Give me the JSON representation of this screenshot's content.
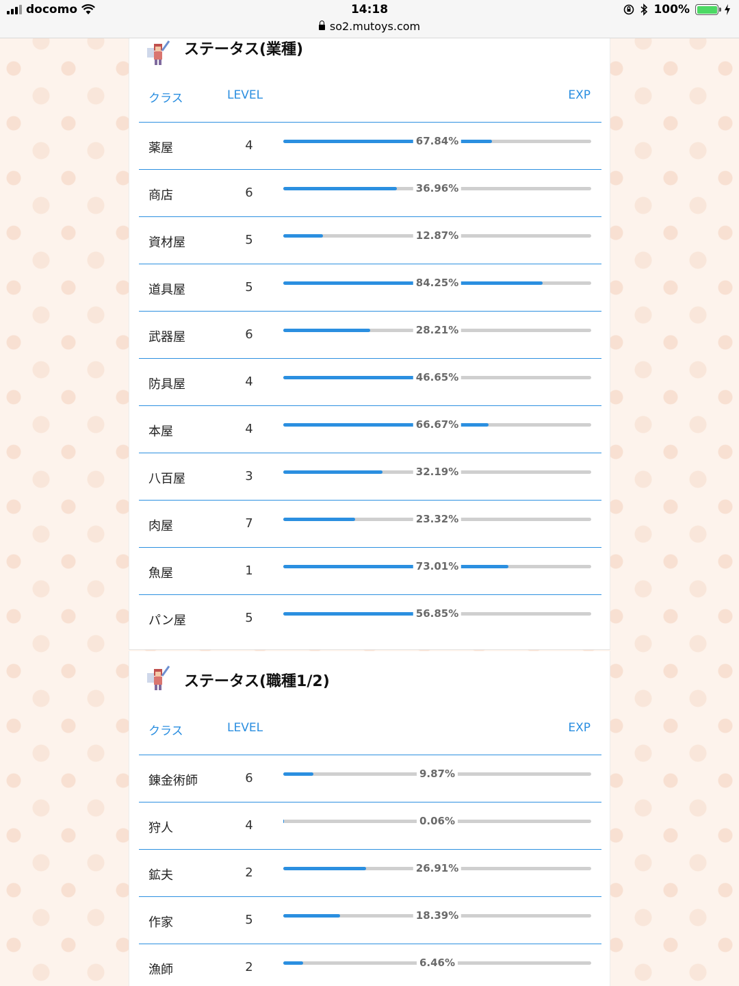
{
  "statusbar": {
    "carrier": "docomo",
    "time": "14:18",
    "url": "so2.mutoys.com",
    "battery": "100%",
    "battery_level": 1.0
  },
  "section1": {
    "title": "ステータス(業種)",
    "header": {
      "class": "クラス",
      "level": "LEVEL",
      "exp": "EXP"
    },
    "rows": [
      {
        "name": "薬屋",
        "level": "4",
        "exp": "67.84%",
        "progress": 0.6784
      },
      {
        "name": "商店",
        "level": "6",
        "exp": "36.96%",
        "progress": 0.3696
      },
      {
        "name": "資材屋",
        "level": "5",
        "exp": "12.87%",
        "progress": 0.1287
      },
      {
        "name": "道具屋",
        "level": "5",
        "exp": "84.25%",
        "progress": 0.8425
      },
      {
        "name": "武器屋",
        "level": "6",
        "exp": "28.21%",
        "progress": 0.2821
      },
      {
        "name": "防具屋",
        "level": "4",
        "exp": "46.65%",
        "progress": 0.4665
      },
      {
        "name": "本屋",
        "level": "4",
        "exp": "66.67%",
        "progress": 0.6667
      },
      {
        "name": "八百屋",
        "level": "3",
        "exp": "32.19%",
        "progress": 0.3219
      },
      {
        "name": "肉屋",
        "level": "7",
        "exp": "23.32%",
        "progress": 0.2332
      },
      {
        "name": "魚屋",
        "level": "1",
        "exp": "73.01%",
        "progress": 0.7301
      },
      {
        "name": "パン屋",
        "level": "5",
        "exp": "56.85%",
        "progress": 0.5685
      }
    ]
  },
  "section2": {
    "title": "ステータス(職種1/2)",
    "header": {
      "class": "クラス",
      "level": "LEVEL",
      "exp": "EXP"
    },
    "rows": [
      {
        "name": "錬金術師",
        "level": "6",
        "exp": "9.87%",
        "progress": 0.0987
      },
      {
        "name": "狩人",
        "level": "4",
        "exp": "0.06%",
        "progress": 0.0006
      },
      {
        "name": "鉱夫",
        "level": "2",
        "exp": "26.91%",
        "progress": 0.2691
      },
      {
        "name": "作家",
        "level": "5",
        "exp": "18.39%",
        "progress": 0.1839
      },
      {
        "name": "漁師",
        "level": "2",
        "exp": "6.46%",
        "progress": 0.0646
      }
    ]
  },
  "colors": {
    "accent": "#2b8fe0",
    "track": "#cfcfcf",
    "battery": "#4cd964"
  }
}
